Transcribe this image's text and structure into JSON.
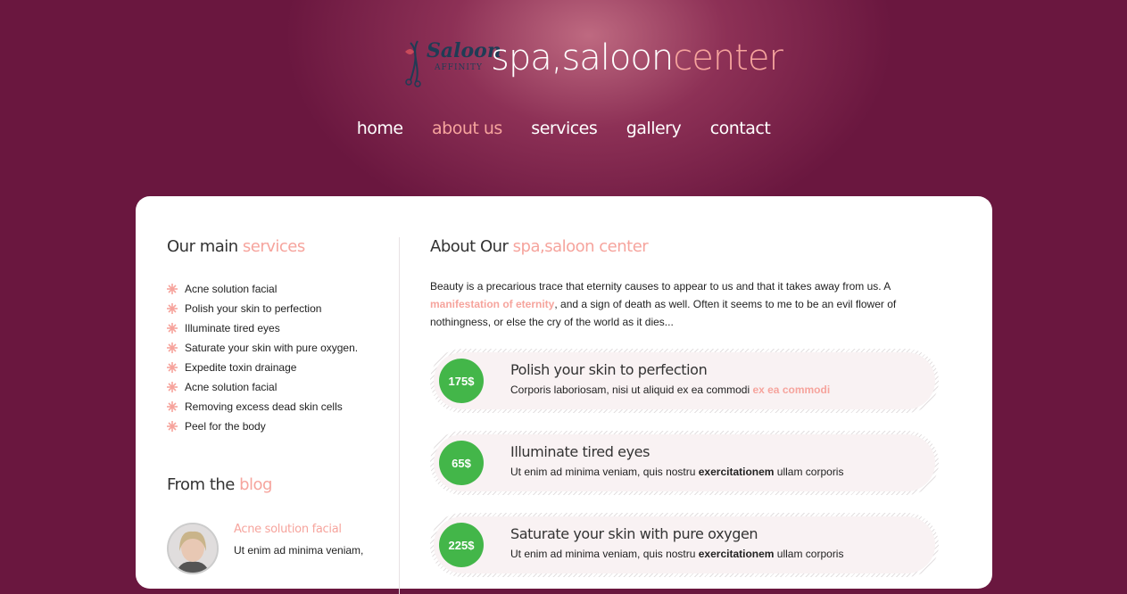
{
  "header": {
    "logo": {
      "script": "Saloon",
      "sub": "AFFINITY"
    },
    "tagline_main": "spa,saloon",
    "tagline_accent": "center"
  },
  "nav": {
    "items": [
      {
        "label": "home",
        "active": false
      },
      {
        "label": "about us",
        "active": true
      },
      {
        "label": "services",
        "active": false
      },
      {
        "label": "gallery",
        "active": false
      },
      {
        "label": "contact",
        "active": false
      }
    ]
  },
  "sidebar": {
    "services_heading": "Our main ",
    "services_heading_accent": "services",
    "services": [
      "Acne solution facial",
      "Polish your skin to perfection",
      "Illuminate tired eyes",
      "Saturate your skin with pure oxygen.",
      "Expedite toxin drainage",
      "Acne solution facial",
      "Removing excess dead skin cells",
      "Peel for the body"
    ],
    "blog_heading": "From the ",
    "blog_heading_accent": "blog",
    "blog_post": {
      "title": "Acne solution facial",
      "text": "Ut enim ad minima veniam,"
    }
  },
  "main": {
    "heading": "About Our ",
    "heading_accent": "spa,saloon center",
    "intro_1": "Beauty is a precarious trace that eternity causes to appear to us and that it takes away from us. A ",
    "intro_link": "manifestation of eternity",
    "intro_2": ", and a sign of death as well. Often it seems to me to be an evil flower of nothingness, or else the cry of the world as it dies...",
    "prices": [
      {
        "price": "175$",
        "title": "Polish your skin to perfection",
        "desc": "Corporis laboriosam, nisi ut aliquid ex ea commodi ",
        "desc_accent": "ex ea commodi",
        "desc_bold": "",
        "desc_end": ""
      },
      {
        "price": "65$",
        "title": "Illuminate tired eyes",
        "desc": "Ut enim ad minima veniam, quis nostru ",
        "desc_accent": "",
        "desc_bold": "exercitationem",
        "desc_end": " ullam corporis"
      },
      {
        "price": "225$",
        "title": "Saturate your skin with pure oxygen",
        "desc": "Ut enim ad minima veniam, quis nostru ",
        "desc_accent": "",
        "desc_bold": "exercitationem",
        "desc_end": " ullam corporis"
      }
    ]
  },
  "colors": {
    "background": "#6a173f",
    "accent": "#f6a49d",
    "badge": "#43b649"
  }
}
